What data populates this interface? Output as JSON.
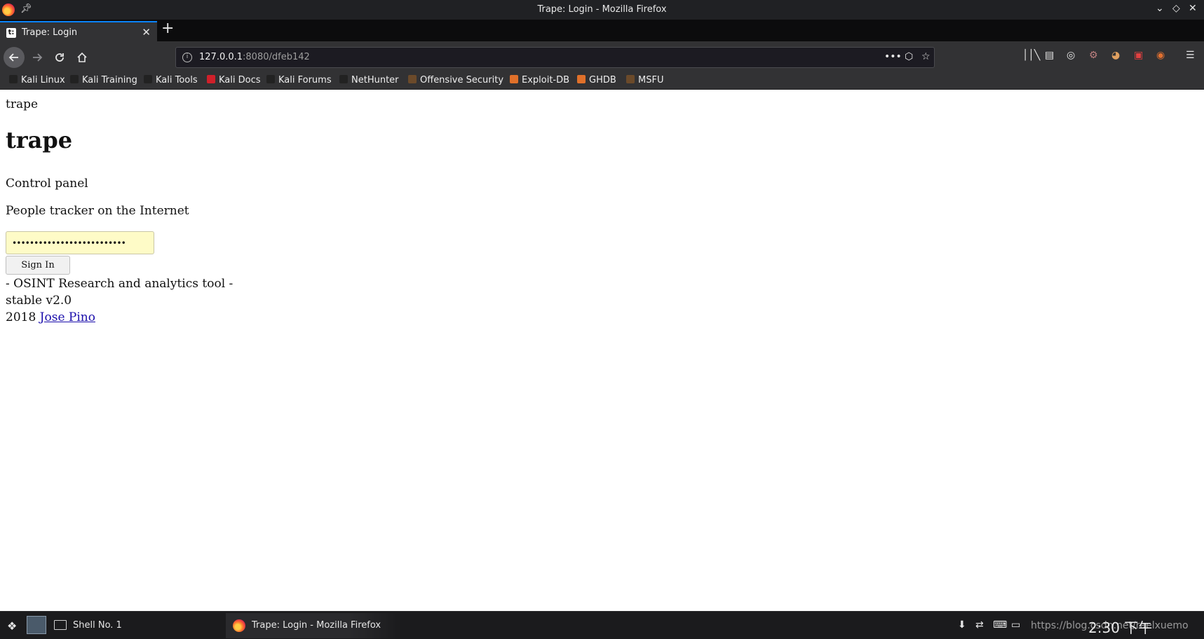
{
  "window": {
    "title": "Trape: Login - Mozilla Firefox"
  },
  "tabs": [
    {
      "label": "Trape: Login",
      "favicon": "t:"
    }
  ],
  "navbar": {
    "url_host": "127.0.0.1",
    "url_rest": ":8080/dfeb142"
  },
  "bookmarks": [
    {
      "label": "Kali Linux",
      "icon": "kali-dragon-icon",
      "color": "#222222"
    },
    {
      "label": "Kali Training",
      "icon": "kali-dragon-icon",
      "color": "#222222"
    },
    {
      "label": "Kali Tools",
      "icon": "kali-dragon-icon",
      "color": "#222222"
    },
    {
      "label": "Kali Docs",
      "icon": "kali-docs-icon",
      "color": "#d0202a"
    },
    {
      "label": "Kali Forums",
      "icon": "kali-dragon-icon",
      "color": "#222222"
    },
    {
      "label": "NetHunter",
      "icon": "nethunter-icon",
      "color": "#222222"
    },
    {
      "label": "Offensive Security",
      "icon": "offsec-icon",
      "color": "#6b4a2a"
    },
    {
      "label": "Exploit-DB",
      "icon": "exploitdb-icon",
      "color": "#e0702a"
    },
    {
      "label": "GHDB",
      "icon": "ghdb-icon",
      "color": "#e0702a"
    },
    {
      "label": "MSFU",
      "icon": "msfu-icon",
      "color": "#6b4a2a"
    }
  ],
  "page": {
    "site_name": "trape",
    "heading": "trape",
    "subtitle": "Control panel",
    "tagline": "People tracker on the Internet",
    "password_value": "••••••••••••••••••••••••••",
    "signin_label": "Sign In",
    "footer_line1": "- OSINT Research and analytics tool -",
    "footer_line2": "stable v2.0",
    "footer_year": "2018",
    "footer_author": "Jose Pino"
  },
  "taskbar": {
    "shell_label": "Shell No. 1",
    "firefox_label": "Trape: Login - Mozilla Firefox",
    "clock": "2:30 下午",
    "watermark": "https://blog.csdn.net/raelxuemo"
  },
  "colors": {
    "titlebar": "#202124",
    "toolbar": "#323234",
    "accent": "#0a84ff",
    "autofill": "#fefbc7",
    "link": "#1a0dab"
  }
}
